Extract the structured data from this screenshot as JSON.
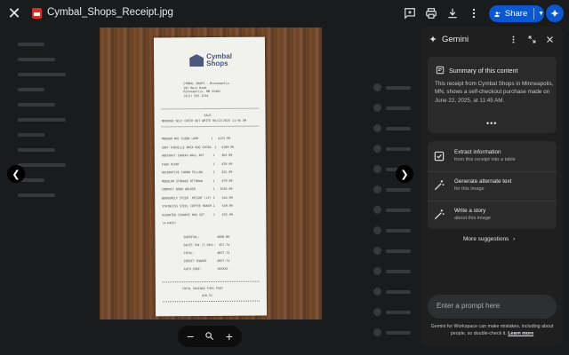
{
  "file": {
    "name": "Cymbal_Shops_Receipt.jpg"
  },
  "toolbar": {
    "share_label": "Share"
  },
  "receipt": {
    "brand": [
      "Cymbal",
      "Shops"
    ],
    "header_lines": [
      "CYMBAL SHOPS - Minneapolis",
      "101 Main Road",
      "Minneapolis, MN 55401",
      "(612) 555-1234"
    ],
    "sale_line": "SALE",
    "checkout_line": "ORDERED SELF CHECK OUT WRITE 06/22/2025 11:45 AM",
    "items": [
      "MODERN ARC FLOOR LAMP       1   $122.99",
      "SOFT CHENILLE AREA RUG COCOA  1   $189.99",
      "ABSTRACT CANVAS WALL ART     1    $64.99",
      "FAUX PLANT                   1    $29.99",
      "DECORATIVE THROW PILLOW      1    $22.99",
      "MODULAR STORAGE OTTOMAN      1    $79.99",
      "COMPACT BOOK HOLDER          1   $102.99",
      "BOOKSHELF 5TIER  HEIGHT (LF) 1    $44.99",
      "STAINLESS STEEL COFFEE MAKER 1    $49.99",
      "ASSORTED CERAMIC MUG SET     1    $32.99",
      "(4-PACK)"
    ],
    "totals": [
      "SUBTOTAL:          $800.00",
      "SALES TAX (7.28%):  $57.74",
      "TOTAL:             $857.74",
      "CREDIT CHARGE      $857.74",
      "AUTH CODE:         XXXXXX"
    ],
    "footer": [
      "TOTAL SAVINGS THIS TRIP",
      "$10.52"
    ]
  },
  "gemini": {
    "title": "Gemini",
    "summary_title": "Summary of this content",
    "summary_text": "This receipt from Cymbal Shops in Minneapolis, MN, shows a self-checkout purchase made on June 22, 2025, at 11:45 AM.",
    "more": "•••",
    "actions": [
      {
        "title": "Extract information",
        "subtitle": "from this receipt into a table"
      },
      {
        "title": "Generate alternate text",
        "subtitle": "for this image"
      },
      {
        "title": "Write a story",
        "subtitle": "about this image"
      }
    ],
    "more_suggestions": "More suggestions",
    "prompt_placeholder": "Enter a prompt here",
    "disclaimer": "Gemini for Workspace can make mistakes, including about people, so double-check it.",
    "learn_more": "Learn more"
  },
  "colors": {
    "accent": "#0b57d0",
    "panel": "#1f1f1f",
    "card": "#2a2a2a",
    "background": "#1a1b1d"
  },
  "icons": {
    "topbar": [
      "close-icon",
      "add-comment-icon",
      "print-icon",
      "download-icon",
      "more-vert-icon",
      "share-people-icon",
      "gemini-spark-icon"
    ],
    "viewer": [
      "chevron-left-icon",
      "chevron-right-icon",
      "zoom-out-icon",
      "zoom-icon",
      "zoom-in-icon"
    ]
  }
}
